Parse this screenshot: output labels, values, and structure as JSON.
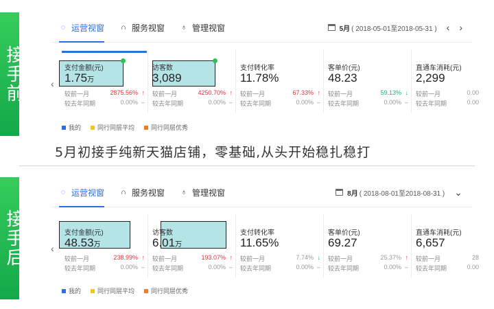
{
  "before": {
    "side_label": "接手前",
    "tabs": [
      {
        "label": "运营视窗",
        "icon": "shield-icon",
        "active": true
      },
      {
        "label": "服务视窗",
        "icon": "headset-icon",
        "active": false
      },
      {
        "label": "管理视窗",
        "icon": "medal-icon",
        "active": false
      }
    ],
    "date": {
      "month": "5月",
      "range": "( 2018-05-01至2018-05-31 )"
    },
    "metrics": [
      {
        "name": "支付金额(元)",
        "value": "1.75",
        "unit": "万",
        "mom_label": "较前一月",
        "mom": "2875.56%",
        "mom_trend": "up",
        "yoy_label": "较去年同期",
        "yoy": "0.00%",
        "yoy_trend": "flat"
      },
      {
        "name": "访客数",
        "value": "3,089",
        "unit": "",
        "mom_label": "较前一月",
        "mom": "4250.70%",
        "mom_trend": "up",
        "yoy_label": "较去年同期",
        "yoy": "0.00%",
        "yoy_trend": "flat"
      },
      {
        "name": "支付转化率",
        "value": "11.78%",
        "unit": "",
        "mom_label": "较前一月",
        "mom": "67.33%",
        "mom_trend": "up",
        "yoy_label": "较去年同期",
        "yoy": "0.00%",
        "yoy_trend": "flat"
      },
      {
        "name": "客单价(元)",
        "value": "48.23",
        "unit": "",
        "mom_label": "较前一月",
        "mom": "59.13%",
        "mom_trend": "down",
        "yoy_label": "较去年同期",
        "yoy": "0.00%",
        "yoy_trend": "flat"
      },
      {
        "name": "直通车消耗(元)",
        "value": "2,299",
        "unit": "",
        "mom_label": "较前一月",
        "mom": "0.00",
        "mom_trend": "none",
        "yoy_label": "较去年同期",
        "yoy": "0.00",
        "yoy_trend": "none"
      }
    ],
    "legend": [
      "我的",
      "同行同层平均",
      "同行同层优秀"
    ]
  },
  "caption": "5月初接手纯新天猫店铺，零基础,从头开始稳扎稳打",
  "after": {
    "side_label": "接手后",
    "tabs": [
      {
        "label": "运营视窗",
        "icon": "shield-icon",
        "active": true
      },
      {
        "label": "服务视窗",
        "icon": "headset-icon",
        "active": false
      },
      {
        "label": "管理视窗",
        "icon": "medal-icon",
        "active": false
      }
    ],
    "date": {
      "month": "8月",
      "range": "( 2018-08-01至2018-08-31 )"
    },
    "metrics": [
      {
        "name": "支付金额(元)",
        "value": "48.53",
        "unit": "万",
        "mom_label": "较前一月",
        "mom": "238.99%",
        "mom_trend": "up",
        "yoy_label": "较去年同期",
        "yoy": "0.00%",
        "yoy_trend": "flat"
      },
      {
        "name": "访客数",
        "value": "6.01",
        "unit": "万",
        "mom_label": "较前一月",
        "mom": "193.07%",
        "mom_trend": "up",
        "yoy_label": "较去年同期",
        "yoy": "0.00%",
        "yoy_trend": "flat"
      },
      {
        "name": "支付转化率",
        "value": "11.65%",
        "unit": "",
        "mom_label": "较前一月",
        "mom": "7.74%",
        "mom_trend": "down",
        "yoy_label": "较去年同期",
        "yoy": "0.00%",
        "yoy_trend": "flat"
      },
      {
        "name": "客单价(元)",
        "value": "69.27",
        "unit": "",
        "mom_label": "较前一月",
        "mom": "25.37%",
        "mom_trend": "up",
        "yoy_label": "较去年同期",
        "yoy": "0.00%",
        "yoy_trend": "flat"
      },
      {
        "name": "直通车消耗(元)",
        "value": "6,657",
        "unit": "",
        "mom_label": "较前一月",
        "mom": "28",
        "mom_trend": "none",
        "yoy_label": "较去年同期",
        "yoy": "0.00",
        "yoy_trend": "none"
      }
    ],
    "legend": [
      "我的",
      "同行同层平均",
      "同行同层优秀"
    ]
  },
  "colors": {
    "accent": "#2d6ee6",
    "up": "#e2313c",
    "down": "#18b67b",
    "side_green": "#1fb24f",
    "legend_mine": "#2d6ee6",
    "legend_avg": "#f5c518",
    "legend_excellent": "#f07a2a"
  }
}
